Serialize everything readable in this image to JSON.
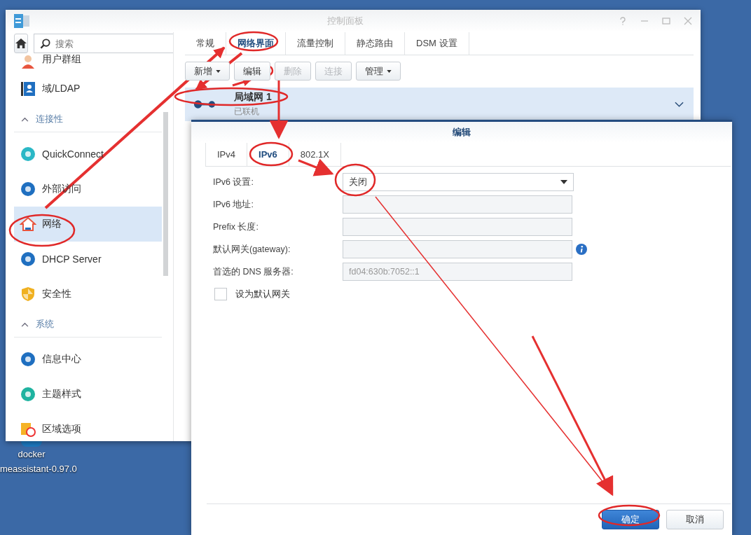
{
  "window": {
    "title": "控制面板"
  },
  "search": {
    "placeholder": "搜索"
  },
  "sidebar": [
    {
      "kind": "item",
      "label": "用户群组",
      "selected": false
    },
    {
      "kind": "item",
      "label": "域/LDAP",
      "selected": false
    },
    {
      "kind": "section",
      "label": "连接性",
      "expanded": true
    },
    {
      "kind": "item",
      "label": "QuickConnect",
      "selected": false
    },
    {
      "kind": "item",
      "label": "外部访问",
      "selected": false
    },
    {
      "kind": "item",
      "label": "网络",
      "selected": true
    },
    {
      "kind": "item",
      "label": "DHCP Server",
      "selected": false
    },
    {
      "kind": "item",
      "label": "安全性",
      "selected": false
    },
    {
      "kind": "section",
      "label": "系统",
      "expanded": true
    },
    {
      "kind": "item",
      "label": "信息中心",
      "selected": false
    },
    {
      "kind": "item",
      "label": "主题样式",
      "selected": false
    },
    {
      "kind": "item",
      "label": "区域选项",
      "selected": false
    }
  ],
  "tabs": [
    {
      "label": "常规",
      "selected": false
    },
    {
      "label": "网络界面",
      "selected": true
    },
    {
      "label": "流量控制",
      "selected": false
    },
    {
      "label": "静态路由",
      "selected": false
    },
    {
      "label": "DSM 设置",
      "selected": false
    }
  ],
  "toolbar": [
    {
      "label": "新增",
      "menu": true,
      "disabled": false
    },
    {
      "label": "编辑",
      "menu": false,
      "disabled": false
    },
    {
      "label": "删除",
      "menu": false,
      "disabled": true
    },
    {
      "label": "连接",
      "menu": false,
      "disabled": true
    },
    {
      "label": "管理",
      "menu": true,
      "disabled": false
    }
  ],
  "interfaces": [
    {
      "name": "局域网 1",
      "status": "已联机",
      "selected": true
    }
  ],
  "dialog": {
    "title": "编辑",
    "tabs": [
      {
        "label": "IPv4",
        "selected": false
      },
      {
        "label": "IPv6",
        "selected": true
      },
      {
        "label": "802.1X",
        "selected": false
      }
    ],
    "fields": [
      {
        "kind": "select",
        "label": "IPv6 设置:",
        "value": "关闭",
        "disabled": false
      },
      {
        "kind": "text",
        "label": "IPv6 地址:",
        "disabled": true
      },
      {
        "kind": "text",
        "label": "Prefix 长度:",
        "disabled": true
      },
      {
        "kind": "text",
        "label": "默认网关(gateway):",
        "disabled": true,
        "info": true
      },
      {
        "kind": "text",
        "label": "首选的 DNS 服务器:",
        "value": "fd04:630b:7052::1",
        "disabled": true
      }
    ],
    "checkbox": {
      "label": "设为默认网关",
      "checked": false
    },
    "buttons": [
      {
        "label": "确定",
        "primary": true
      },
      {
        "label": "取消",
        "primary": false
      }
    ]
  },
  "desktop": [
    {
      "label": "docker"
    },
    {
      "label": "meassistant-0.97.0"
    }
  ]
}
